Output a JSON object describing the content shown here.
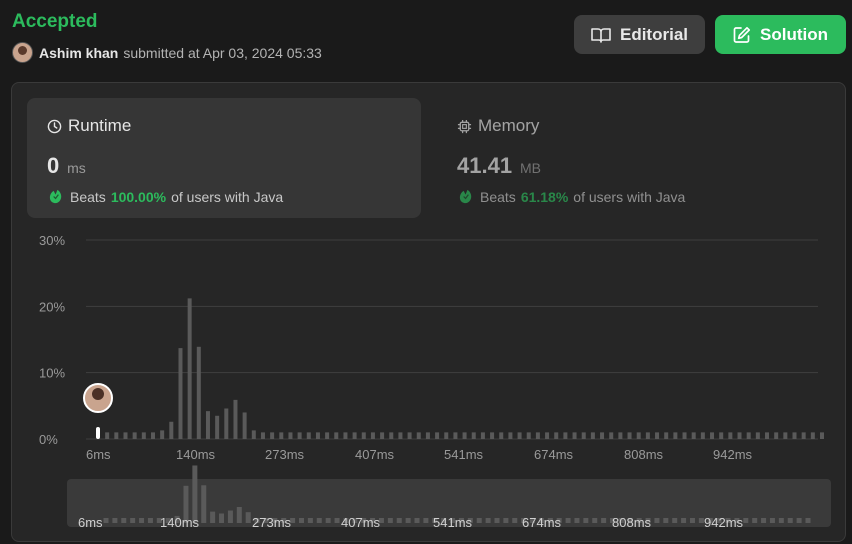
{
  "header": {
    "status": "Accepted",
    "user": "Ashim khan",
    "submitted_text": "submitted at Apr 03, 2024 05:33"
  },
  "buttons": {
    "editorial": "Editorial",
    "solution": "Solution"
  },
  "runtime": {
    "title": "Runtime",
    "value": "0",
    "unit": "ms",
    "beats_label": "Beats",
    "beats_pct": "100.00%",
    "beats_suffix": "of users with Java"
  },
  "memory": {
    "title": "Memory",
    "value": "41.41",
    "unit": "MB",
    "beats_label": "Beats",
    "beats_pct": "61.18%",
    "beats_suffix": "of users with Java"
  },
  "colors": {
    "accent": "#2cbb5d",
    "bar": "#5a5a5a",
    "highlight": "#ffffff"
  },
  "chart_data": {
    "type": "bar",
    "ylabel_ticks": [
      "0%",
      "10%",
      "20%",
      "30%"
    ],
    "ylim": [
      0,
      30
    ],
    "x_tick_labels": [
      "6ms",
      "140ms",
      "273ms",
      "407ms",
      "541ms",
      "674ms",
      "808ms",
      "942ms"
    ],
    "values": [
      1.8,
      1,
      1,
      1,
      1,
      1,
      1,
      1.3,
      2.6,
      13.7,
      21.2,
      13.9,
      4.2,
      3.5,
      4.6,
      5.9,
      4,
      1.3,
      1,
      1,
      1,
      1,
      1,
      1,
      1,
      1,
      1,
      1,
      1,
      1,
      1,
      1,
      1,
      1,
      1,
      1,
      1,
      1,
      1,
      1,
      1,
      1,
      1,
      1,
      1,
      1,
      1,
      1,
      1,
      1,
      1,
      1,
      1,
      1,
      1,
      1,
      1,
      1,
      1,
      1,
      1,
      1,
      1,
      1,
      1,
      1,
      1,
      1,
      1,
      1,
      1,
      1,
      1,
      1,
      1,
      1,
      1,
      1,
      1,
      1
    ],
    "highlight_index": 0,
    "grid": true
  }
}
